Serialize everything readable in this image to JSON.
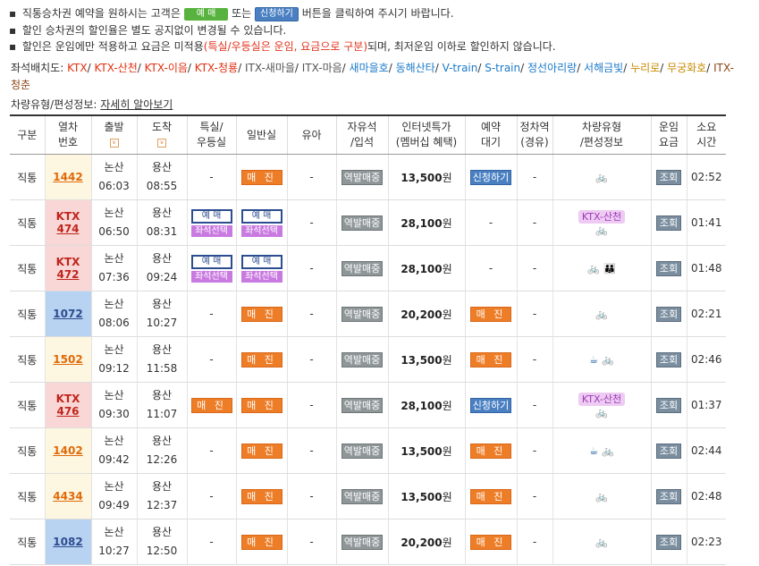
{
  "notices": {
    "n1": {
      "bullet": "▪",
      "pre": "직통승차권 예약을 원하시는 고객은",
      "btn_book": "예 매",
      "mid": "또는",
      "btn_apply": "신청하기",
      "post": "버튼을 클릭하여 주시기 바랍니다."
    },
    "n2": {
      "bullet": "▪",
      "text": "할인 승차권의 할인율은 별도 공지없이 변경될 수 있습니다."
    },
    "n3": {
      "bullet": "▪",
      "pre": "할인은 운임에만 적용하고 요금은 미적용",
      "red": "(특실/우등실은 운임, 요금으로 구분)",
      "post": "되며, 최저운임 이하로 할인하지 않습니다."
    }
  },
  "seatmap": {
    "label": "좌석배치도:",
    "links": [
      "KTX",
      "KTX-산천",
      "KTX-이음",
      "KTX-청룡",
      "ITX-새마을",
      "ITX-마음",
      "새마을호",
      "동해산타",
      "V-train",
      "S-train",
      "정선아리랑",
      "서해금빛",
      "누리로",
      "무궁화호",
      "ITX-청춘"
    ],
    "colors": [
      "#e03010",
      "#e03010",
      "#e03010",
      "#e03010",
      "#555555",
      "#555555",
      "#1a79c9",
      "#1a79c9",
      "#1a79c9",
      "#1a79c9",
      "#1a79c9",
      "#1a79c9",
      "#c98a00",
      "#c98a00",
      "#8b4513"
    ]
  },
  "carinfo": {
    "label": "차량유형/편성정보:",
    "link": "자세히 알아보기"
  },
  "headers": {
    "h1": "구분",
    "h2a": "열차",
    "h2b": "번호",
    "h3": "출발",
    "h4": "도착",
    "h5a": "특실/",
    "h5b": "우등실",
    "h6": "일반실",
    "h7": "유아",
    "h8a": "자유석",
    "h8b": "/입석",
    "h9a": "인터넷특가",
    "h9b": "(멤버십 혜택)",
    "h10a": "예약",
    "h10b": "대기",
    "h11a": "정차역",
    "h11b": "(경유)",
    "h12a": "차량유형",
    "h12b": "/편성정보",
    "h13a": "운임",
    "h13b": "요금",
    "h14a": "소요",
    "h14b": "시간"
  },
  "common": {
    "sort_mark": "v",
    "dash": "-",
    "sold_out": "매 진",
    "standing": "역발매중",
    "book": "예 매",
    "seat_select": "좌석선택",
    "apply": "신청하기",
    "inquiry": "조회",
    "won": "원",
    "kind": "직통",
    "ktx": "KTX",
    "from": "논산",
    "to": "용산"
  },
  "rows": [
    {
      "no": "1442",
      "dep": "06:03",
      "arr": "08:55",
      "price": "13,500",
      "dur": "02:52"
    },
    {
      "no": "474",
      "dep": "06:50",
      "arr": "08:31",
      "price": "28,100",
      "dur": "01:41",
      "badge": "KTX-산천"
    },
    {
      "no": "472",
      "dep": "07:36",
      "arr": "09:24",
      "price": "28,100",
      "dur": "01:48"
    },
    {
      "no": "1072",
      "dep": "08:06",
      "arr": "10:27",
      "price": "20,200",
      "dur": "02:21"
    },
    {
      "no": "1502",
      "dep": "09:12",
      "arr": "11:58",
      "price": "13,500",
      "dur": "02:46"
    },
    {
      "no": "476",
      "dep": "09:30",
      "arr": "11:07",
      "price": "28,100",
      "dur": "01:37",
      "badge": "KTX-산천"
    },
    {
      "no": "1402",
      "dep": "09:42",
      "arr": "12:26",
      "price": "13,500",
      "dur": "02:44"
    },
    {
      "no": "4434",
      "dep": "09:49",
      "arr": "12:37",
      "price": "13,500",
      "dur": "02:48"
    },
    {
      "no": "1082",
      "dep": "10:27",
      "arr": "12:50",
      "price": "20,200",
      "dur": "02:23"
    }
  ],
  "icons": {
    "wheelchair": "wheelchair-icon",
    "family": "family-icon",
    "cafe": "cafe-icon",
    "bike": "bicycle-icon"
  }
}
